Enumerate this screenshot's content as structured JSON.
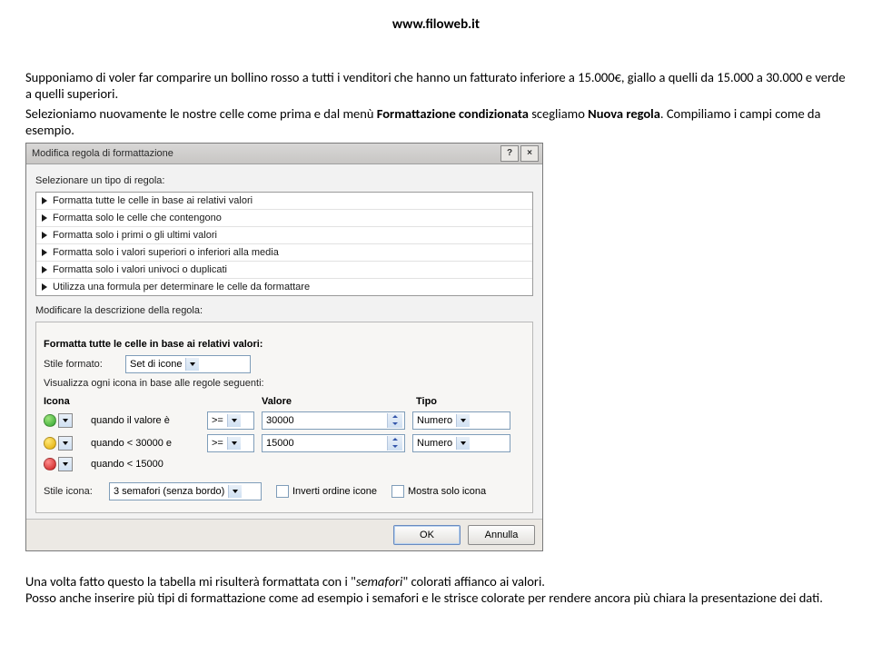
{
  "header": {
    "url": "www.filoweb.it"
  },
  "intro": {
    "p1": "Supponiamo di voler far comparire un bollino rosso a tutti i venditori che hanno un fatturato inferiore a 15.000€, giallo a quelli da 15.000 a 30.000 e verde a quelli superiori.",
    "p2a": "Selezioniamo nuovamente le nostre celle come prima e dal menù ",
    "p2b": "Formattazione condizionata",
    "p2c": " scegliamo ",
    "p2d": "Nuova regola",
    "p2e": ". Compiliamo i campi come da esempio."
  },
  "dialog": {
    "title": "Modifica regola di formattazione",
    "help": "?",
    "close": "×",
    "selectRuleLabel": "Selezionare un tipo di regola:",
    "rules": [
      "Formatta tutte le celle in base ai relativi valori",
      "Formatta solo le celle che contengono",
      "Formatta solo i primi o gli ultimi valori",
      "Formatta solo i valori superiori o inferiori alla media",
      "Formatta solo i valori univoci o duplicati",
      "Utilizza una formula per determinare le celle da formattare"
    ],
    "modifyDescLabel": "Modificare la descrizione della regola:",
    "sectionTitle": "Formatta tutte le celle in base ai relativi valori:",
    "styleLabel": "Stile formato:",
    "styleValue": "Set di icone",
    "displayDesc": "Visualizza ogni icona in base alle regole seguenti:",
    "headers": {
      "icon": "Icona",
      "value": "Valore",
      "type": "Tipo"
    },
    "rows": [
      {
        "color": "green",
        "cond": "quando il valore è",
        "op": ">=",
        "val": "30000",
        "type": "Numero"
      },
      {
        "color": "yellow",
        "cond": "quando < 30000 e",
        "op": ">=",
        "val": "15000",
        "type": "Numero"
      },
      {
        "color": "red",
        "cond": "quando < 15000",
        "op": "",
        "val": "",
        "type": ""
      }
    ],
    "iconStyleLabel": "Stile icona:",
    "iconStyleValue": "3 semafori (senza bordo)",
    "invertLabel": "Inverti ordine icone",
    "onlyIconLabel": "Mostra solo icona",
    "ok": "OK",
    "cancel": "Annulla"
  },
  "outro": {
    "p1a": "Una volta fatto questo la tabella mi risulterà formattata con i \"",
    "p1b": "semafori",
    "p1c": "\" colorati affianco ai valori.",
    "p2": "Posso anche inserire più tipi di formattazione come ad esempio i semafori e le strisce colorate per rendere ancora più chiara la presentazione dei dati."
  }
}
